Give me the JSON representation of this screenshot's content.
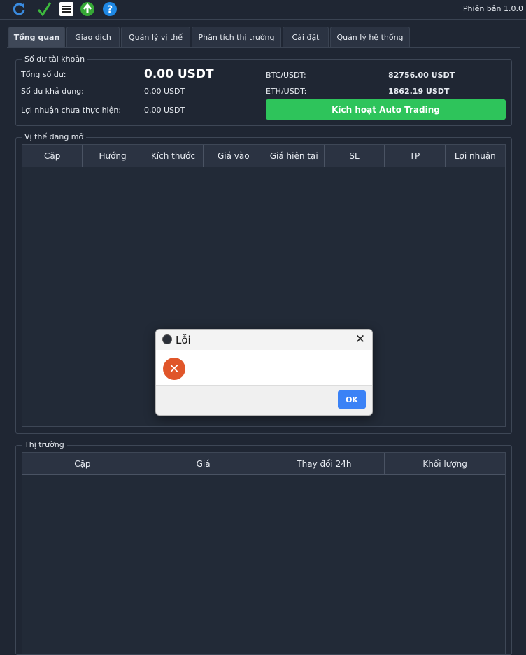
{
  "toolbar": {
    "icons": [
      "refresh-icon",
      "checkmark-icon",
      "list-icon",
      "upload-arrow-icon",
      "help-icon"
    ],
    "version": "Phiên bản 1.0.0"
  },
  "tabs": [
    {
      "label": "Tổng quan",
      "active": true
    },
    {
      "label": "Giao dịch",
      "active": false
    },
    {
      "label": "Quản lý vị thế",
      "active": false
    },
    {
      "label": "Phân tích thị trường",
      "active": false
    },
    {
      "label": "Cài đặt",
      "active": false
    },
    {
      "label": "Quản lý hệ thống",
      "active": false
    }
  ],
  "balance": {
    "title": "Số dư tài khoản",
    "total_label": "Tổng số dư:",
    "total_value": "0.00 USDT",
    "available_label": "Số dư khả dụng:",
    "available_value": "0.00 USDT",
    "unrealized_label": "Lợi nhuận chưa thực hiện:",
    "unrealized_value": "0.00 USDT",
    "btc_label": "BTC/USDT:",
    "btc_value": "82756.00 USDT",
    "eth_label": "ETH/USDT:",
    "eth_value": "1862.19 USDT",
    "auto_button": "Kích hoạt Auto Trading"
  },
  "positions": {
    "title": "Vị thế đang mở",
    "columns": [
      "Cặp",
      "Hướng",
      "Kích thước",
      "Giá vào",
      "Giá hiện tại",
      "SL",
      "TP",
      "Lợi nhuận"
    ]
  },
  "market": {
    "title": "Thị trường",
    "columns": [
      "Cặp",
      "Giá",
      "Thay đổi 24h",
      "Khối lượng"
    ]
  },
  "dialog": {
    "title": "Lỗi",
    "ok": "OK"
  },
  "colors": {
    "background": "#1f2633",
    "accent_green": "#2ec45b",
    "ok_blue": "#3b82f6",
    "error_red": "#e0562a"
  }
}
